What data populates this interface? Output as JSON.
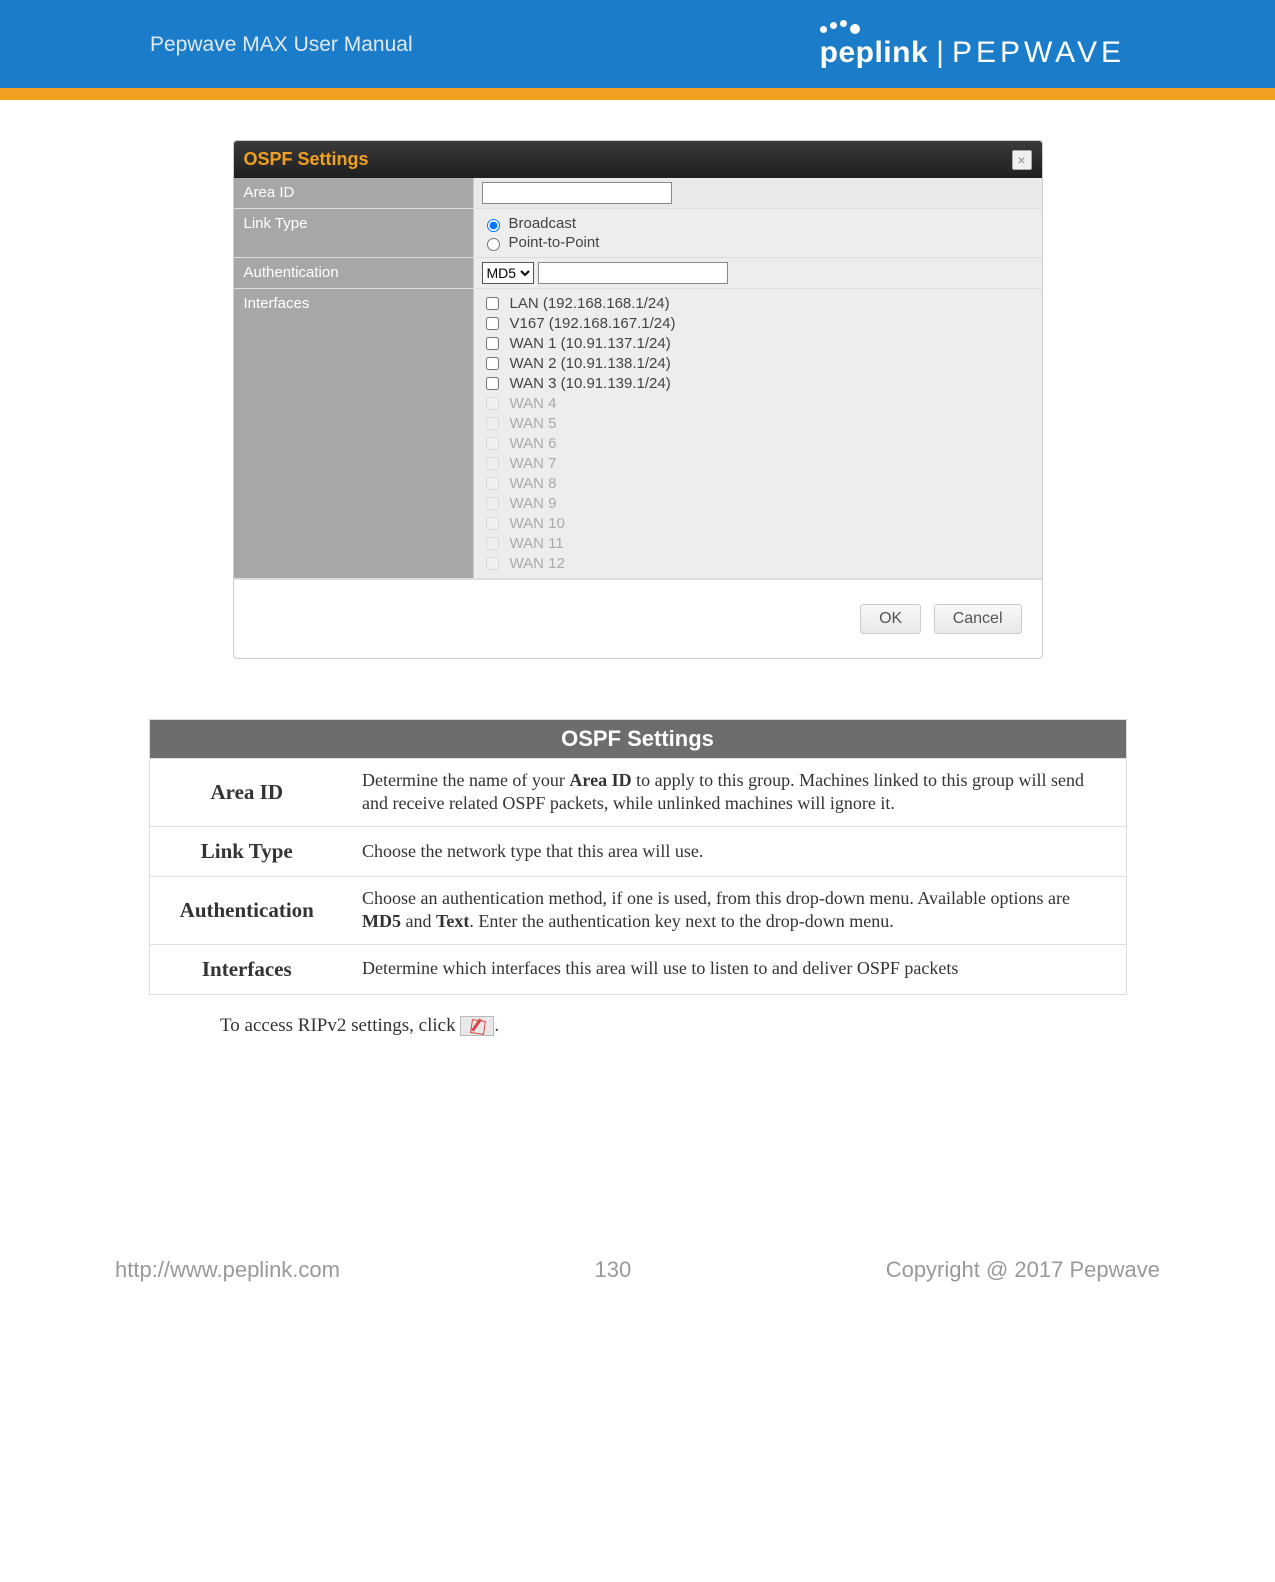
{
  "header": {
    "title": "Pepwave MAX User Manual",
    "brand1": "peplink",
    "brand2": "PEPWAVE"
  },
  "dialog": {
    "title": "OSPF Settings",
    "labels": {
      "area_id": "Area ID",
      "link_type": "Link Type",
      "authentication": "Authentication",
      "interfaces": "Interfaces"
    },
    "area_id_value": "",
    "link_type": {
      "broadcast": "Broadcast",
      "p2p": "Point-to-Point",
      "selected": "broadcast"
    },
    "auth": {
      "options": [
        "MD5"
      ],
      "selected": "MD5",
      "key": ""
    },
    "interfaces": [
      {
        "label": "LAN (192.168.168.1/24)",
        "disabled": false
      },
      {
        "label": "V167 (192.168.167.1/24)",
        "disabled": false
      },
      {
        "label": "WAN 1 (10.91.137.1/24)",
        "disabled": false
      },
      {
        "label": "WAN 2 (10.91.138.1/24)",
        "disabled": false
      },
      {
        "label": "WAN 3 (10.91.139.1/24)",
        "disabled": false
      },
      {
        "label": "WAN 4",
        "disabled": true
      },
      {
        "label": "WAN 5",
        "disabled": true
      },
      {
        "label": "WAN 6",
        "disabled": true
      },
      {
        "label": "WAN 7",
        "disabled": true
      },
      {
        "label": "WAN 8",
        "disabled": true
      },
      {
        "label": "WAN 9",
        "disabled": true
      },
      {
        "label": "WAN 10",
        "disabled": true
      },
      {
        "label": "WAN 11",
        "disabled": true
      },
      {
        "label": "WAN 12",
        "disabled": true
      }
    ],
    "buttons": {
      "ok": "OK",
      "cancel": "Cancel"
    }
  },
  "desc": {
    "title": "OSPF Settings",
    "rows": [
      {
        "label": "Area ID",
        "html": "Determine the name of your <b>Area ID</b> to apply to this group. Machines linked to this group will send and receive related OSPF packets, while unlinked machines will ignore it."
      },
      {
        "label": "Link Type",
        "html": "Choose the network type that this area will use."
      },
      {
        "label": "Authentication",
        "html": "Choose an authentication method, if one is used, from this drop-down menu. Available options are <b>MD5</b> and <b>Text</b>. Enter the authentication key next to the drop-down menu."
      },
      {
        "label": "Interfaces",
        "html": "Determine which interfaces this area will use to listen to and deliver OSPF packets"
      }
    ]
  },
  "follow_text": "To access RIPv2 settings, click ",
  "footer": {
    "url": "http://www.peplink.com",
    "page": "130",
    "copyright": "Copyright @ 2017 Pepwave"
  }
}
